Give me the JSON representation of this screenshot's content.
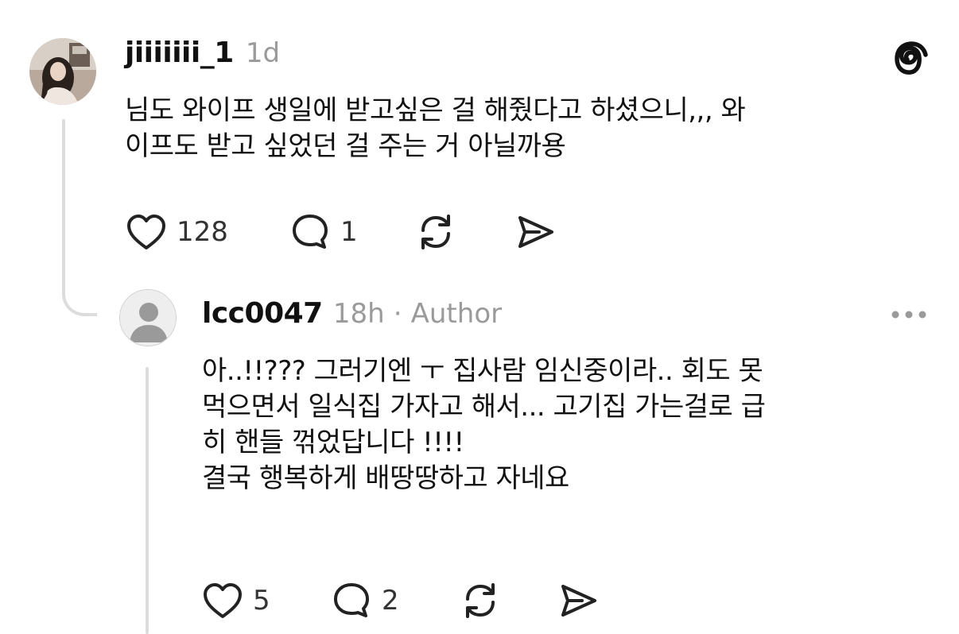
{
  "post": {
    "username": "jiiiiiii_1",
    "time": "1d",
    "lines": [
      "님도 와이프 생일에 받고싶은 걸 해줬다고 하셨으니,,, 와",
      "이프도 받고 싶었던 걸 주는 거 아닐까용"
    ],
    "likes": "128",
    "replies": "1",
    "icons": {
      "app": "threads-logo-icon",
      "like": "heart-icon",
      "reply": "comment-icon",
      "repost": "repost-icon",
      "share": "send-icon"
    }
  },
  "reply": {
    "username": "lcc0047",
    "time": "18h",
    "separator": "·",
    "badge": "Author",
    "lines": [
      "아..!!??? 그러기엔 ㅜ 집사람 임신중이라.. 회도 못",
      "먹으면서 일식집 가자고 해서... 고기집 가는걸로 급",
      "히 핸들 꺾었답니다 !!!!",
      "결국 행복하게 배땅땅하고 자네요"
    ],
    "likes": "5",
    "replies": "2",
    "icons": {
      "more": "more-dots-icon",
      "like": "heart-icon",
      "reply": "comment-icon",
      "repost": "repost-icon",
      "share": "send-icon"
    }
  },
  "colors": {
    "text": "#111111",
    "muted": "#9a9a9a",
    "thread_line": "#dcdcdc",
    "background": "#ffffff"
  }
}
